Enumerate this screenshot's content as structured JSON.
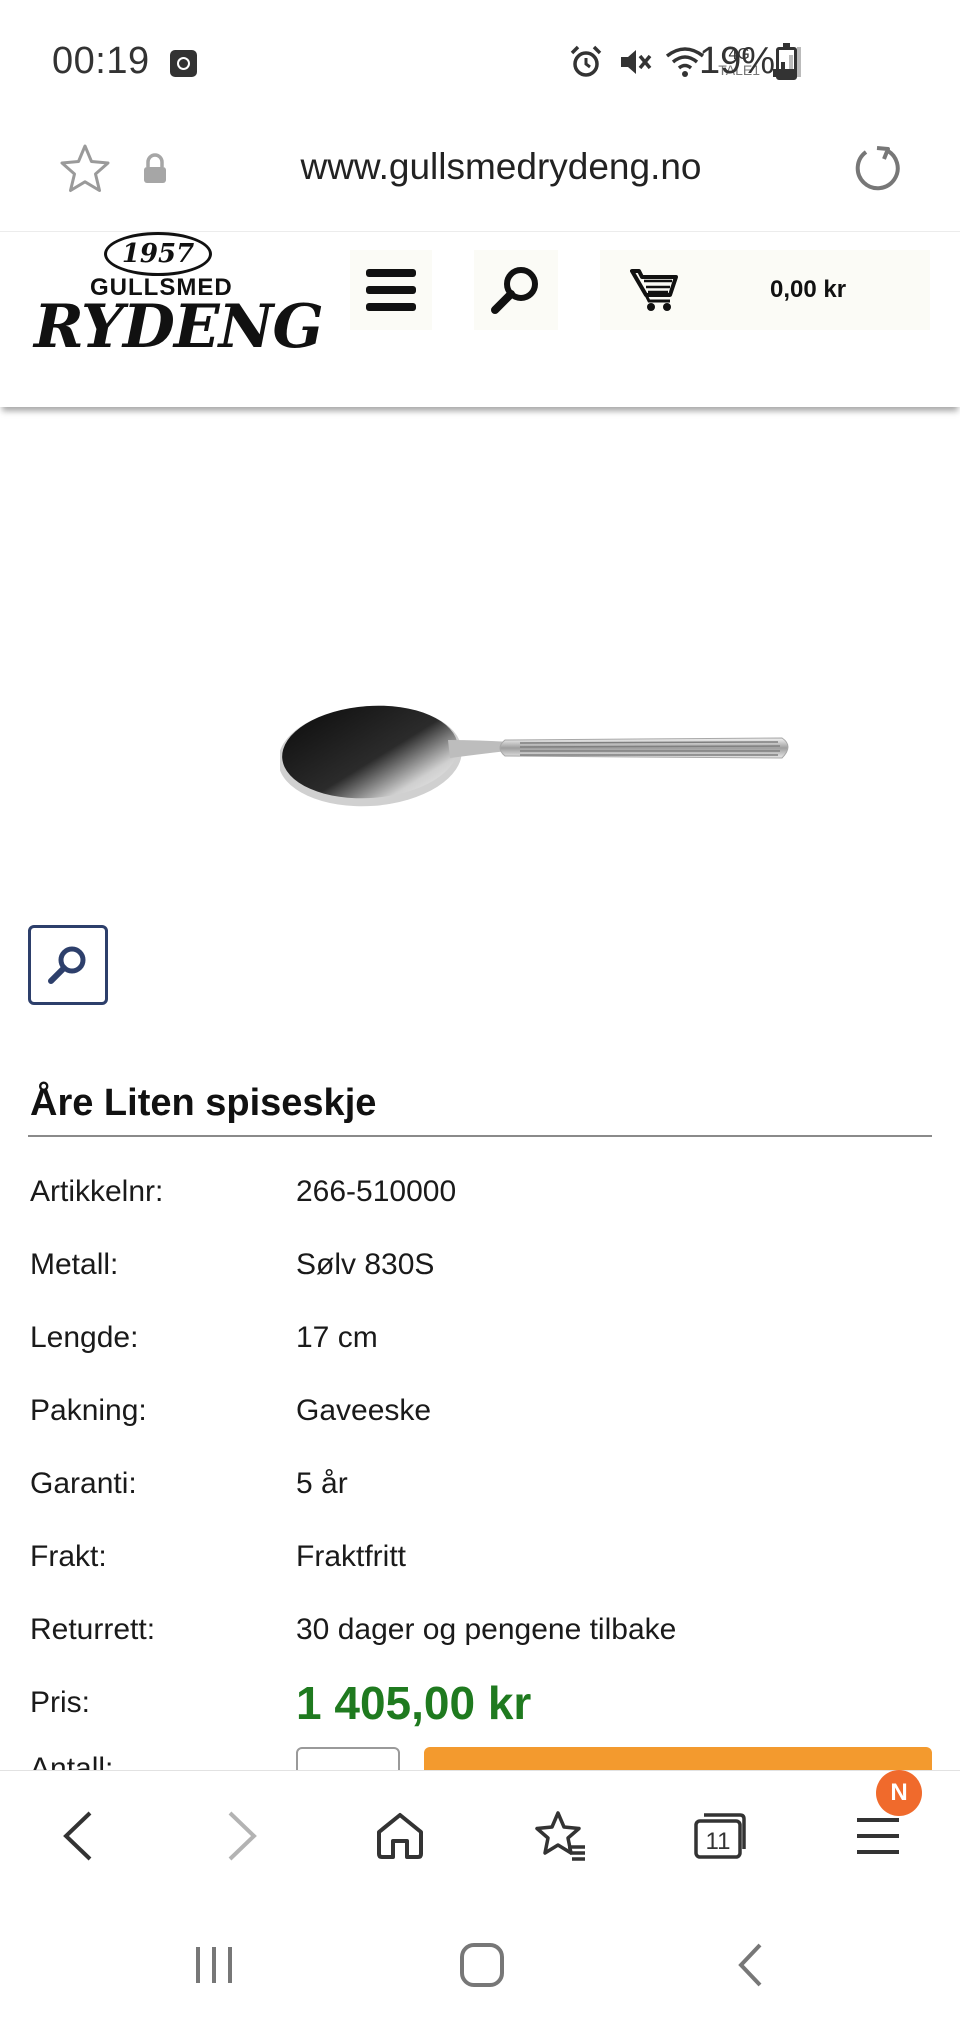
{
  "status_bar": {
    "time": "00:19",
    "network_label_top": "4G",
    "network_label_bottom": "TALE1",
    "battery_percent": "19%"
  },
  "url_bar": {
    "url": "www.gullsmedrydeng.no"
  },
  "site_header": {
    "logo": {
      "year": "1957",
      "line1": "GULLSMED",
      "line2": "RYDENG"
    },
    "cart_total": "0,00 kr"
  },
  "product": {
    "title": "Åre Liten spiseskje",
    "specs": [
      {
        "label": "Artikkelnr:",
        "value": "266-510000"
      },
      {
        "label": "Metall:",
        "value": "Sølv 830S"
      },
      {
        "label": "Lengde:",
        "value": "17 cm"
      },
      {
        "label": "Pakning:",
        "value": "Gaveeske"
      },
      {
        "label": "Garanti:",
        "value": "5 år"
      },
      {
        "label": "Frakt:",
        "value": "Fraktfritt"
      },
      {
        "label": "Returrett:",
        "value": "30 dager og pengene tilbake"
      }
    ],
    "price_label": "Pris:",
    "price_value": "1 405,00 kr",
    "quantity_label": "Antall:"
  },
  "browser_toolbar": {
    "notification_badge": "N",
    "tabs_count": "11"
  },
  "colors": {
    "price": "#1f7a1f",
    "buy_button": "#f39a2e",
    "zoom_border": "#2d3f6b",
    "badge": "#f06a2c"
  }
}
